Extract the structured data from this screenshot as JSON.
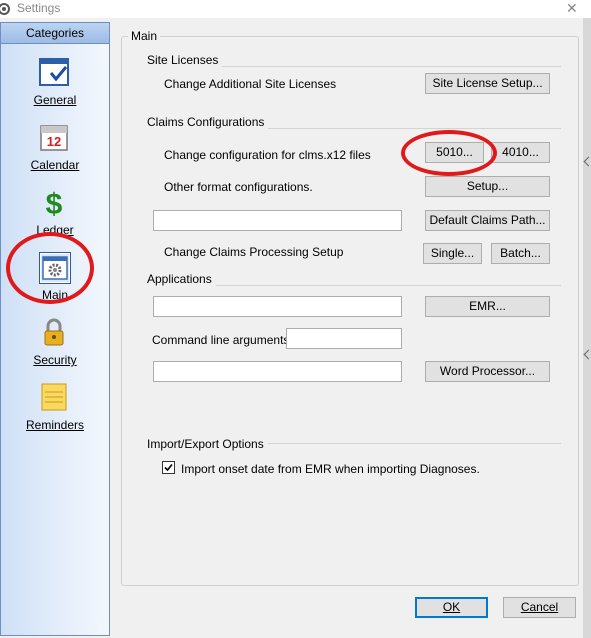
{
  "window": {
    "title": "Settings"
  },
  "categories": {
    "header": "Categories",
    "items": [
      {
        "label": "General",
        "icon": "checkbox-window-icon"
      },
      {
        "label": "Calendar",
        "icon": "calendar-icon"
      },
      {
        "label": "Ledger",
        "icon": "dollar-icon"
      },
      {
        "label": "Main",
        "icon": "gear-window-icon",
        "selected": true
      },
      {
        "label": "Security",
        "icon": "padlock-icon"
      },
      {
        "label": "Reminders",
        "icon": "notepad-icon"
      }
    ]
  },
  "main": {
    "group_title": "Main",
    "site_licenses": {
      "title": "Site Licenses",
      "label": "Change Additional Site Licenses",
      "button": "Site License Setup..."
    },
    "claims": {
      "title": "Claims Configurations",
      "x12_label": "Change configuration for clms.x12 files",
      "btn_5010": "5010...",
      "btn_4010": "4010...",
      "other_label": "Other format configurations.",
      "setup_button": "Setup...",
      "claims_path_value": "",
      "default_path_button": "Default Claims Path...",
      "processing_label": "Change Claims Processing Setup",
      "single_button": "Single...",
      "batch_button": "Batch..."
    },
    "applications": {
      "title": "Applications",
      "emr_path_value": "",
      "emr_button": "EMR...",
      "cmd_label": "Command line arguments:",
      "cmd_value": "",
      "word_path_value": "",
      "word_button": "Word Processor..."
    },
    "import_export": {
      "title": "Import/Export Options",
      "import_onset_label": "Import onset date from EMR when importing Diagnoses.",
      "import_onset_checked": true
    }
  },
  "footer": {
    "ok": "OK",
    "cancel": "Cancel"
  },
  "colors": {
    "accent": "#0078d7",
    "annotation": "#e01a1a"
  }
}
